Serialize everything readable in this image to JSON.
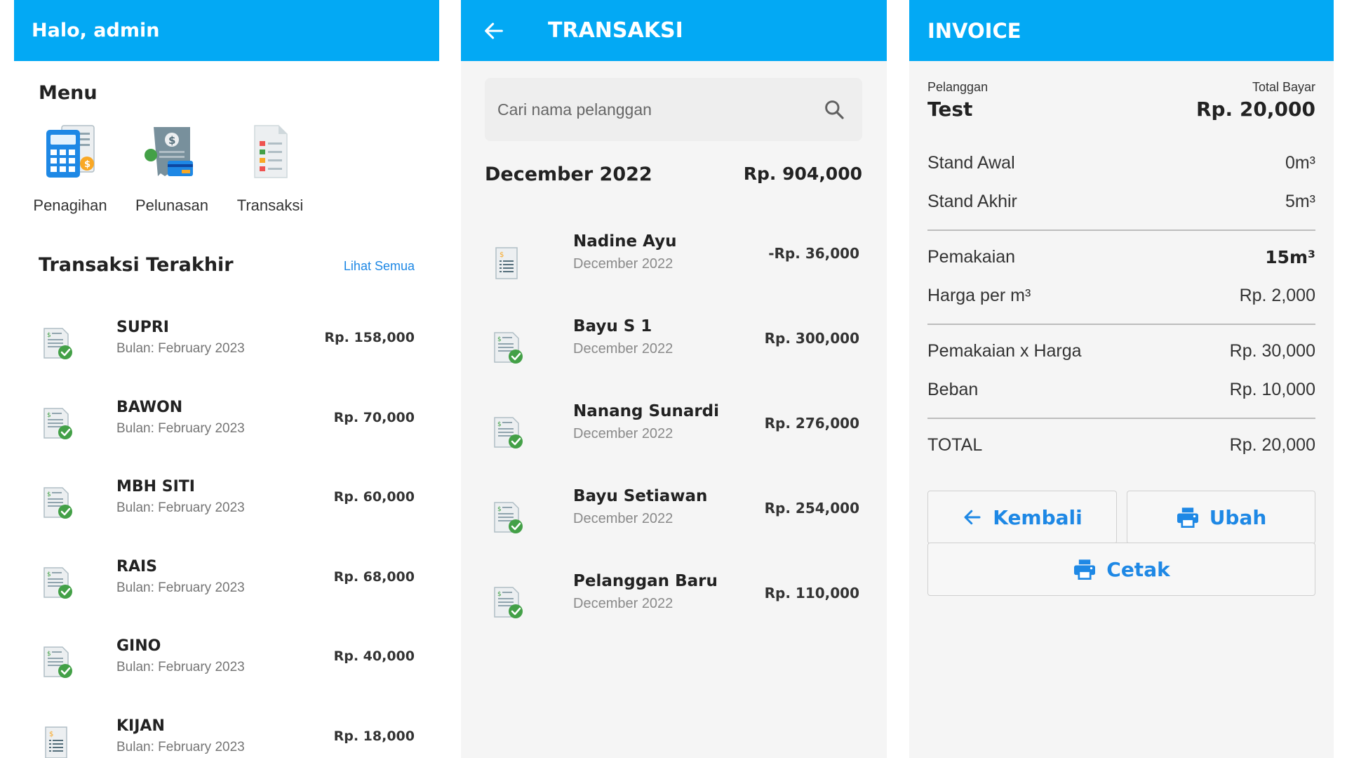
{
  "home": {
    "greeting": "Halo, admin",
    "menu_title": "Menu",
    "menu": [
      {
        "label": "Penagihan",
        "icon": "billing-calculator-icon"
      },
      {
        "label": "Pelunasan",
        "icon": "payment-receipt-icon"
      },
      {
        "label": "Transaksi",
        "icon": "transaction-document-icon"
      }
    ],
    "recent_title": "Transaksi Terakhir",
    "see_all": "Lihat Semua",
    "recent": [
      {
        "name": "SUPRI",
        "sub": "Bulan: February 2023",
        "amount": "Rp. 158,000",
        "paid": true
      },
      {
        "name": "BAWON",
        "sub": "Bulan: February 2023",
        "amount": "Rp. 70,000",
        "paid": true
      },
      {
        "name": "MBH SITI",
        "sub": "Bulan: February 2023",
        "amount": "Rp. 60,000",
        "paid": true
      },
      {
        "name": "RAIS",
        "sub": "Bulan: February 2023",
        "amount": "Rp. 68,000",
        "paid": true
      },
      {
        "name": "GINO",
        "sub": "Bulan: February 2023",
        "amount": "Rp. 40,000",
        "paid": true
      },
      {
        "name": "KIJAN",
        "sub": "Bulan: February 2023",
        "amount": "Rp. 18,000",
        "paid": false
      }
    ]
  },
  "transaksi": {
    "title": "TRANSAKSI",
    "search_placeholder": "Cari nama pelanggan",
    "month": "December 2022",
    "month_total": "Rp. 904,000",
    "rows": [
      {
        "name": "Nadine Ayu",
        "sub": "December 2022",
        "amount": "-Rp. 36,000",
        "paid": false
      },
      {
        "name": "Bayu S 1",
        "sub": "December 2022",
        "amount": "Rp. 300,000",
        "paid": true
      },
      {
        "name": "Nanang Sunardi",
        "sub": "December 2022",
        "amount": "Rp. 276,000",
        "paid": true
      },
      {
        "name": "Bayu Setiawan",
        "sub": "December 2022",
        "amount": "Rp. 254,000",
        "paid": true
      },
      {
        "name": "Pelanggan Baru",
        "sub": "December 2022",
        "amount": "Rp. 110,000",
        "paid": true
      }
    ]
  },
  "invoice": {
    "title": "INVOICE",
    "customer_label": "Pelanggan",
    "customer_name": "Test",
    "total_label": "Total Bayar",
    "total_value": "Rp. 20,000",
    "rows": [
      {
        "label": "Stand Awal",
        "value": "0m³",
        "bold": false
      },
      {
        "label": "Stand Akhir",
        "value": "5m³",
        "bold": false
      },
      {
        "label": "Pemakaian",
        "value": "15m³",
        "bold": true
      },
      {
        "label": "Harga per m³",
        "value": "Rp. 2,000",
        "bold": false
      },
      {
        "label": "Pemakaian x Harga",
        "value": "Rp. 30,000",
        "bold": false
      },
      {
        "label": "Beban",
        "value": "Rp. 10,000",
        "bold": false
      },
      {
        "label": "TOTAL",
        "value": "Rp. 20,000",
        "bold": false
      }
    ],
    "buttons": {
      "back": "Kembali",
      "edit": "Ubah",
      "print": "Cetak"
    }
  },
  "colors": {
    "primary": "#03A9F4",
    "accent": "#1E88E5",
    "check": "#43A047",
    "background": "#F5F5F5"
  }
}
